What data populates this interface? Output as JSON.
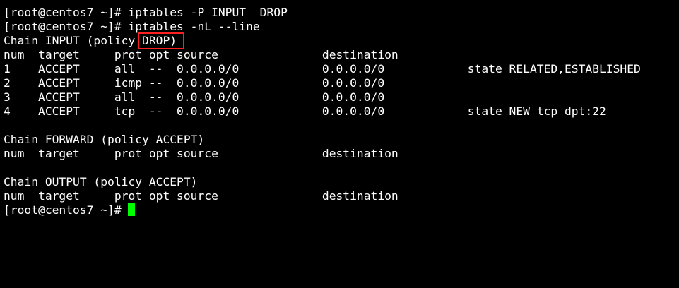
{
  "terminal": {
    "lines": [
      "[root@centos7 ~]# iptables -P INPUT  DROP",
      "[root@centos7 ~]# iptables -nL --line",
      "Chain INPUT (policy DROP)",
      "num  target     prot opt source               destination",
      "1    ACCEPT     all  --  0.0.0.0/0            0.0.0.0/0            state RELATED,ESTABLISHED",
      "2    ACCEPT     icmp --  0.0.0.0/0            0.0.0.0/0",
      "3    ACCEPT     all  --  0.0.0.0/0            0.0.0.0/0",
      "4    ACCEPT     tcp  --  0.0.0.0/0            0.0.0.0/0            state NEW tcp dpt:22",
      "",
      "Chain FORWARD (policy ACCEPT)",
      "num  target     prot opt source               destination",
      "",
      "Chain OUTPUT (policy ACCEPT)",
      "num  target     prot opt source               destination"
    ],
    "prompt": "[root@centos7 ~]# ",
    "colors": {
      "background": "#000000",
      "text": "#ffffff",
      "cursor": "#00ff00",
      "highlight_border": "#ff2020"
    }
  }
}
